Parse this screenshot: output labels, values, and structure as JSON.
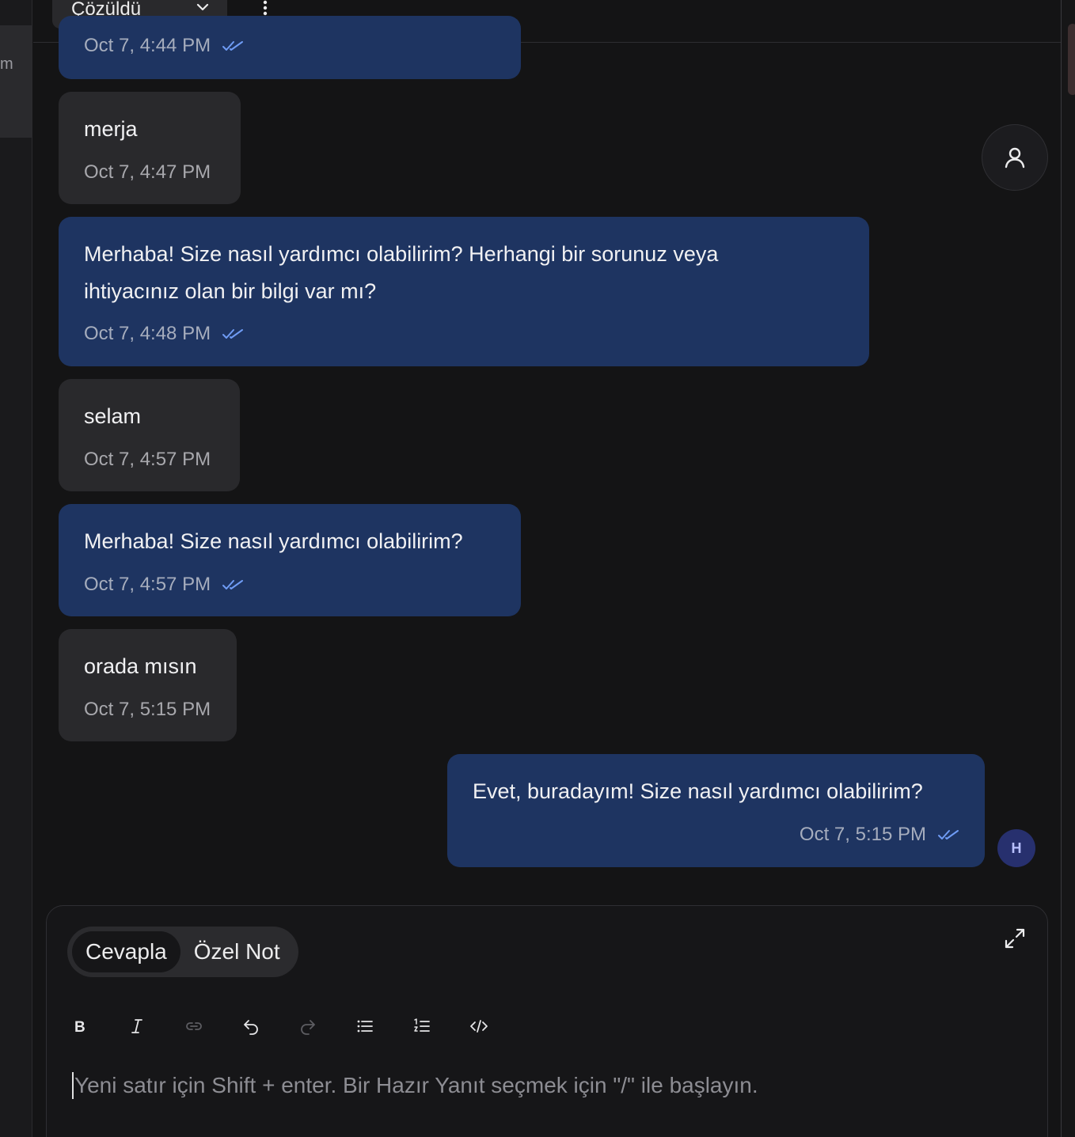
{
  "sidebar_fragment": {
    "visible_text": "m"
  },
  "header": {
    "status_select": "Çözüldü",
    "more_icon": "vertical-dots-icon"
  },
  "messages": [
    {
      "direction": "outgoing",
      "text": "",
      "time": "Oct 7, 4:44 PM",
      "read": true
    },
    {
      "direction": "incoming",
      "text": "merja",
      "time": "Oct 7, 4:47 PM"
    },
    {
      "direction": "outgoing",
      "lines": [
        "Merhaba! Size nasıl yardımcı olabilirim? Herhangi bir sorunuz veya",
        "ihtiyacınız olan bir bilgi var mı?"
      ],
      "time": "Oct 7, 4:48 PM",
      "read": true
    },
    {
      "direction": "incoming",
      "text": "selam",
      "time": "Oct 7, 4:57 PM"
    },
    {
      "direction": "outgoing",
      "text": "Merhaba! Size nasıl yardımcı olabilirim?",
      "time": "Oct 7, 4:57 PM",
      "read": true
    },
    {
      "direction": "incoming",
      "text": "orada mısın",
      "time": "Oct 7, 5:15 PM"
    },
    {
      "direction": "outgoing",
      "text": "Evet, buradayım! Size nasıl yardımcı olabilirim?",
      "time": "Oct 7, 5:15 PM",
      "read": true
    }
  ],
  "agent_avatar": {
    "initial": "H"
  },
  "contact_button_icon": "user-icon",
  "composer": {
    "tabs": [
      {
        "label": "Cevapla",
        "active": true
      },
      {
        "label": "Özel Not",
        "active": false
      }
    ],
    "expand_icon": "expand-icon",
    "toolbar": [
      "bold-icon",
      "italic-icon",
      "link-icon",
      "undo-icon",
      "redo-icon",
      "bullet-list-icon",
      "numbered-list-icon",
      "code-icon"
    ],
    "placeholder": "Yeni satır için Shift + enter. Bir Hazır Yanıt seçmek için \"/\" ile başlayın."
  },
  "colors": {
    "background": "#141415",
    "incoming_bubble": "#29292c",
    "outgoing_bubble": "#1e3461",
    "read_check": "#6f9cf5",
    "avatar_bg": "#27306e"
  }
}
